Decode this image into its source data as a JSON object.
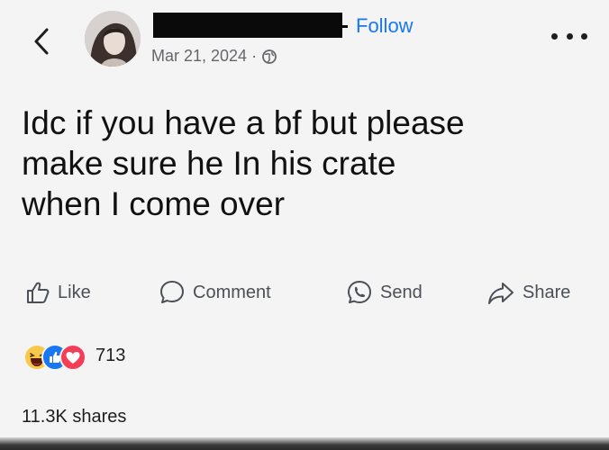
{
  "header": {
    "follow_label": "Follow",
    "date": "Mar 21, 2024",
    "separator": "·"
  },
  "post": {
    "text": "Idc if you have a bf but please\nmake sure he In his crate\nwhen I come over"
  },
  "actions": {
    "like": "Like",
    "comment": "Comment",
    "send": "Send",
    "share": "Share"
  },
  "stats": {
    "reaction_count": "713",
    "shares": "11.3K shares"
  },
  "colors": {
    "accent": "#1877f2",
    "secondary_text": "#65676b"
  },
  "icons": [
    "back-icon",
    "globe-icon",
    "more-icon",
    "like-icon",
    "comment-icon",
    "send-icon",
    "share-icon",
    "haha-reaction-icon",
    "like-reaction-icon",
    "love-reaction-icon"
  ]
}
